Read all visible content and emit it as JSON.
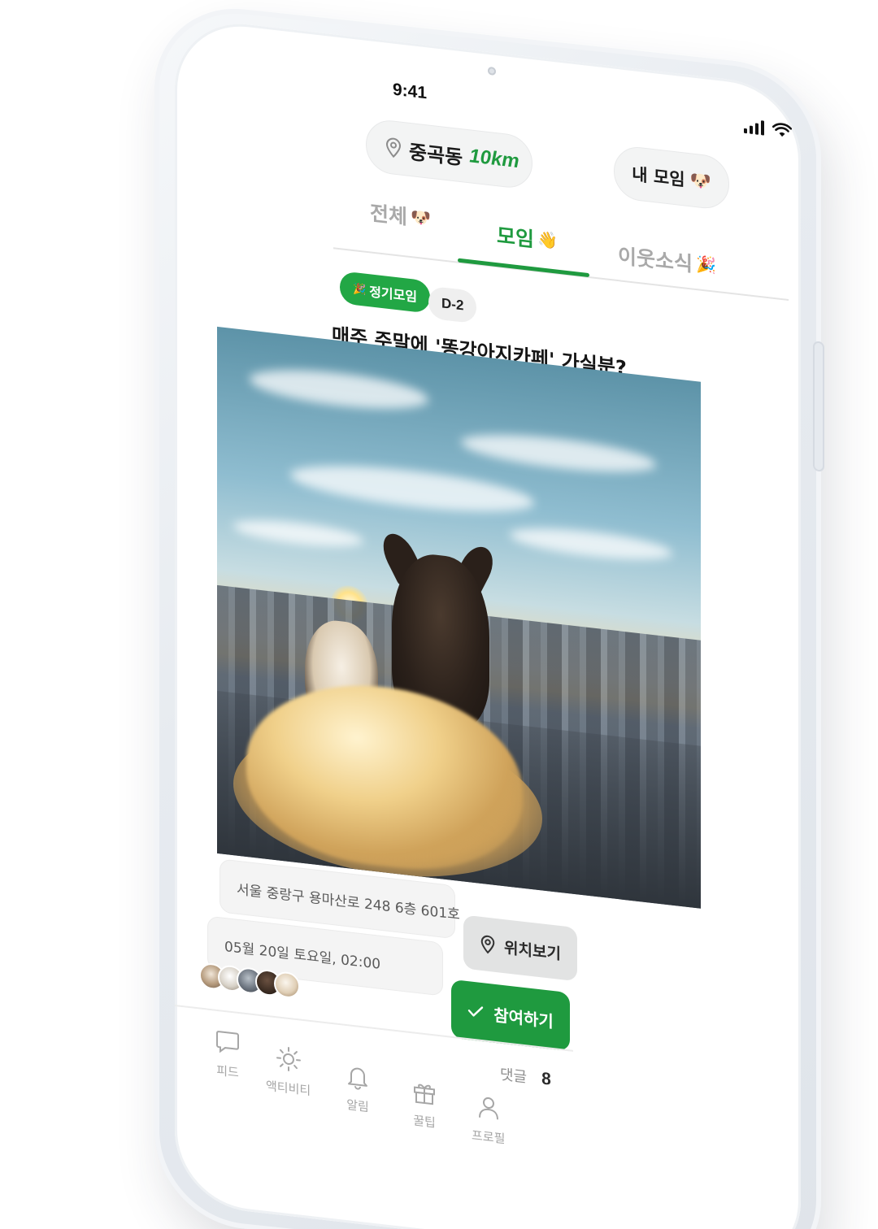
{
  "status_bar": {
    "time": "9:41"
  },
  "header": {
    "location_name": "중곡동",
    "location_distance": "10km",
    "my_group_label": "내 모임",
    "my_group_emoji": "🐶"
  },
  "tabs": [
    {
      "label": "전체",
      "emoji": "🐶",
      "active": false
    },
    {
      "label": "모임",
      "emoji": "👋",
      "active": true
    },
    {
      "label": "이웃소식",
      "emoji": "🎉",
      "active": false
    }
  ],
  "post": {
    "badge_regular": "정기모임",
    "badge_regular_emoji": "🎉",
    "badge_dday": "D-2",
    "title": "매주 주말에 '똥강아지카페' 가실분?",
    "address": "서울 중랑구 용마산로 248 6층 601호",
    "datetime": "05월 20일 토요일, 02:00",
    "location_button": "위치보기",
    "join_button": "참여하기",
    "comment_label": "댓글",
    "comment_count": "8"
  },
  "bottom_nav": [
    {
      "label": "피드",
      "icon": "chat-bubble-icon"
    },
    {
      "label": "액티비티",
      "icon": "sun-icon"
    },
    {
      "label": "알림",
      "icon": "bell-icon"
    },
    {
      "label": "꿀팁",
      "icon": "gift-icon"
    },
    {
      "label": "프로필",
      "icon": "person-icon"
    }
  ],
  "colors": {
    "accent": "#1f9a3f",
    "inactive_tab": "#a9a9a9",
    "field_bg": "#f4f4f4"
  }
}
